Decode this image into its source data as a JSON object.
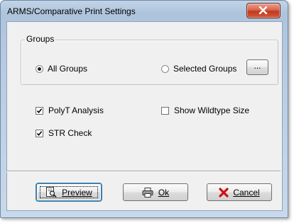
{
  "window": {
    "title": "ARMS/Comparative Print Settings"
  },
  "groups": {
    "legend": "Groups",
    "all_groups_label": "All Groups",
    "all_groups_selected": true,
    "selected_groups_label": "Selected Groups",
    "selected_groups_selected": false,
    "browse_label": "..."
  },
  "options": {
    "polyt_label": "PolyT Analysis",
    "polyt_checked": true,
    "show_wildtype_label": "Show Wildtype Size",
    "show_wildtype_checked": false,
    "str_check_label": "STR Check",
    "str_check_checked": true
  },
  "buttons": {
    "preview_label": "Preview",
    "ok_label": "Ok",
    "cancel_label": "Cancel"
  },
  "icons": {
    "close": "close-icon",
    "preview": "print-preview-icon",
    "ok": "printer-icon",
    "cancel": "red-x-icon"
  },
  "colors": {
    "close_button": "#c2391f",
    "cancel_x": "#d01010",
    "dialog_face": "#f0f0f0"
  }
}
